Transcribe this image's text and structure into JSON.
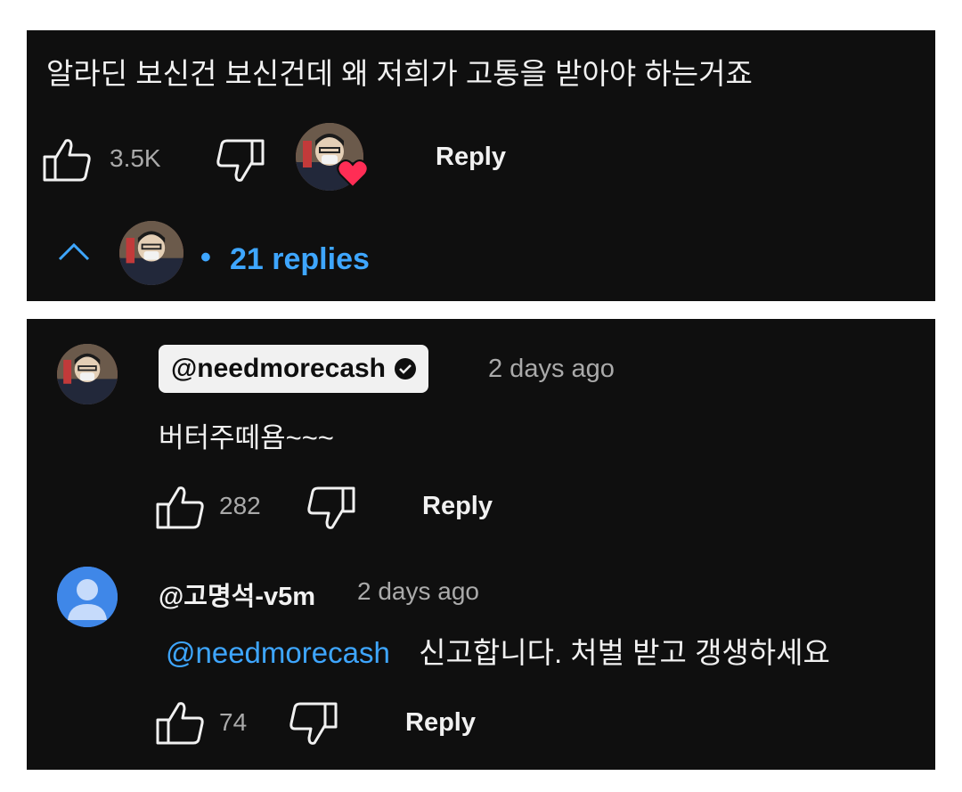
{
  "top_comment": {
    "text": "알라딘 보신건 보신건데 왜 저희가 고통을 받아야 하는거죠",
    "like_count": "3.5K",
    "reply_label": "Reply",
    "replies_toggle": "21 replies",
    "separator": "•"
  },
  "replies": [
    {
      "author": "@needmorecash",
      "timestamp": "2 days ago",
      "text": "버터주떼욤~~~",
      "like_count": "282",
      "reply_label": "Reply",
      "verified": true
    },
    {
      "author": "@고명석-v5m",
      "timestamp": "2 days ago",
      "mention": "@needmorecash",
      "text": "신고합니다. 처벌 받고 갱생하세요",
      "like_count": "74",
      "reply_label": "Reply"
    }
  ],
  "colors": {
    "background": "#0f0f0f",
    "text": "#f1f1f1",
    "muted": "#aaaaaa",
    "link": "#3ea6ff",
    "heart": "#ff2d55",
    "default_avatar": "#3f87e8"
  },
  "icons": {
    "like": "thumbs-up-icon",
    "dislike": "thumbs-down-icon",
    "collapse": "chevron-up-icon",
    "verified": "verified-check-icon",
    "creator_heart": "heart-icon"
  }
}
